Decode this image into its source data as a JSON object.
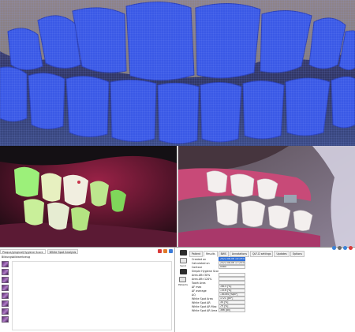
{
  "left_panel": {
    "tabs": [
      {
        "label": "Plaque/gingival/Hygiene Score"
      },
      {
        "label": "White Spot Analysis"
      }
    ],
    "subtitle": "Bildungsbildwerkzeug"
  },
  "toolbar": {
    "tools": [
      {
        "label": ""
      },
      {
        "label": "Send"
      },
      {
        "label": ""
      },
      {
        "label": "Patients"
      }
    ]
  },
  "results": {
    "tabs": [
      "Patient",
      "Results",
      "BWS",
      "Annotations",
      "QLF-D settings",
      "Updates",
      "Options"
    ],
    "active_tab": "Results",
    "rows": [
      {
        "label": "Created on",
        "value": "2022-08-06 14:19:46"
      },
      {
        "label": "Calculated on",
        "value": "2022-08-06 17:20:55"
      },
      {
        "label": "Contour",
        "value": "0080"
      },
      {
        "label": "Simple Hygiene Score",
        "value": ""
      },
      {
        "label": "Area ΔR>30%",
        "value": ""
      },
      {
        "label": "Area ΔR>120%",
        "value": ""
      },
      {
        "label": "Tooth Area",
        "value": ""
      },
      {
        "label": "ΔF max",
        "value": "-46.5 [%]"
      },
      {
        "label": "ΔF average",
        "value": "-15.6 [%]"
      },
      {
        "label": "ΔQ",
        "value": "-16164 [%px²]"
      },
      {
        "label": "White Spot Area",
        "value": "1721 [px²]"
      },
      {
        "label": "White Spot ΔR",
        "value": "34 [%]"
      },
      {
        "label": "White Spot ΔR Max",
        "value": "79 [%]"
      },
      {
        "label": "White Spot ΔR Area",
        "value": "366 [px]"
      }
    ]
  },
  "colors": {
    "scan_tooth": "#3a59e6",
    "scan_background": "#3b3f6e",
    "fluorescence": "#9cf07a",
    "highlight": "#2f6fd8"
  }
}
